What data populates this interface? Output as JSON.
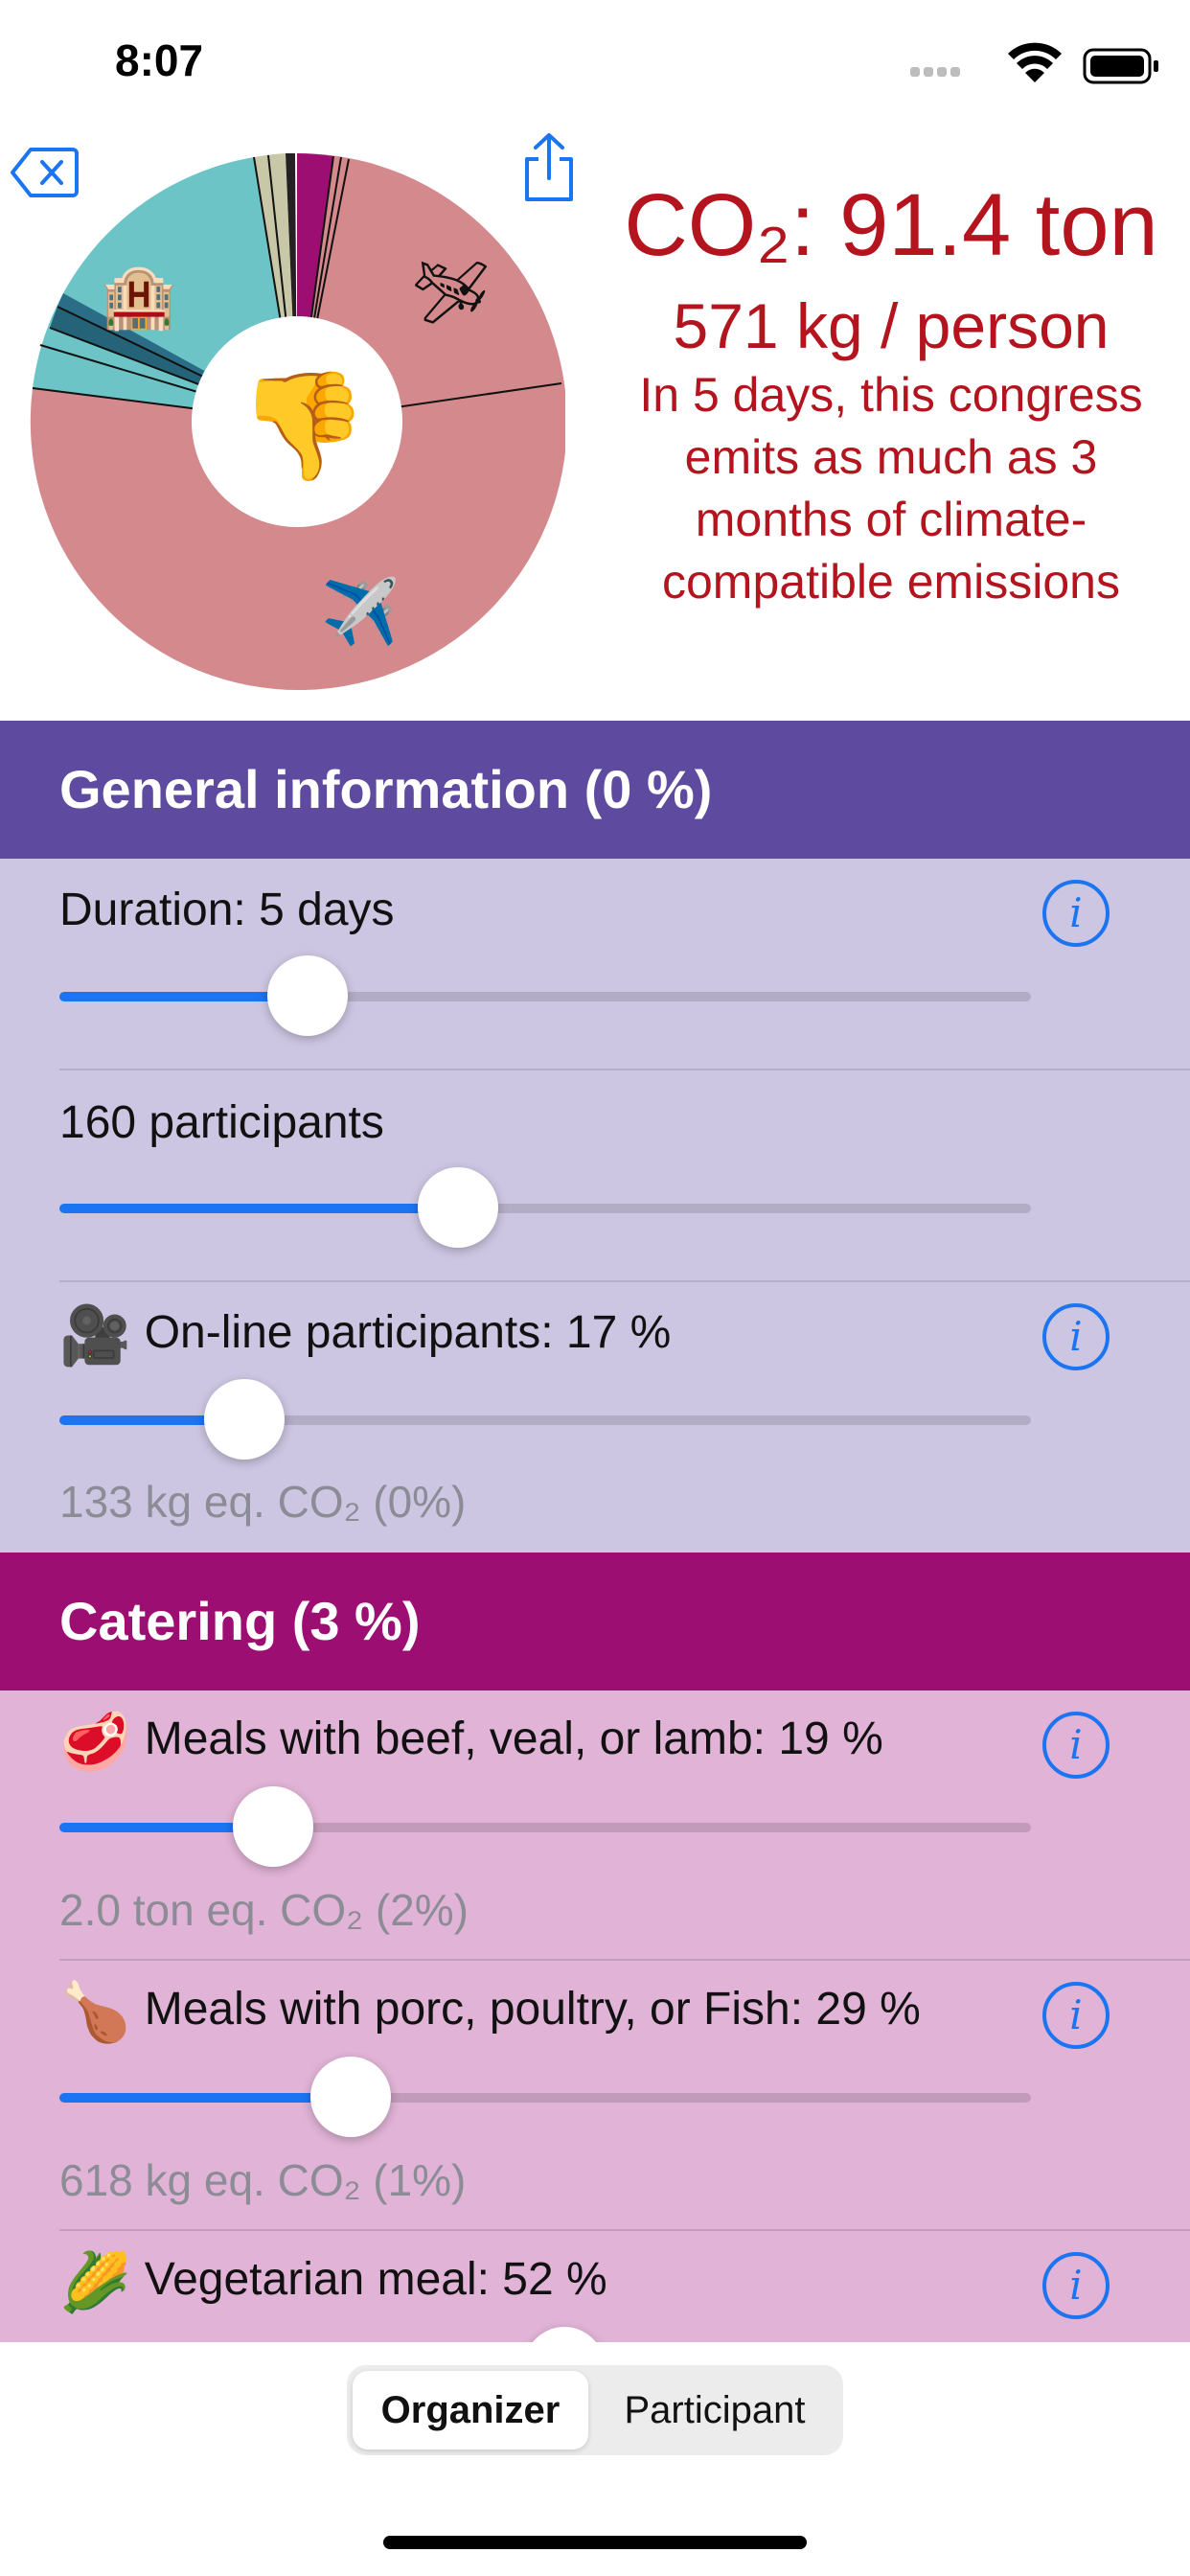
{
  "status": {
    "time": "8:07"
  },
  "header": {
    "co2_title": "CO₂: 91.4 ton",
    "per_person": "571 kg / person",
    "summary": "In 5 days, this congress emits as much as 3 months of climate-compatible emissions",
    "center_emoji": "👎",
    "pie_emojis": {
      "hotel": "🏨",
      "plane_small": "🛩",
      "plane": "✈️"
    }
  },
  "colors": {
    "accent": "#1b75f2",
    "alert_red": "#b3141e",
    "general_header": "#5e4a9f",
    "general_body": "#cdc6e2",
    "catering_header": "#9c0e72",
    "catering_body": "#e1b3d6",
    "pie_travel": "#d4898c",
    "pie_hotel": "#6cc4c6"
  },
  "sections": {
    "general": {
      "title": "General information (0 %)",
      "rows": [
        {
          "label": "Duration: 5 days",
          "slider": 0.255
        },
        {
          "label": "160 participants",
          "slider": 0.41
        },
        {
          "emoji": "🎥",
          "label": "On-line participants: 17 %",
          "slider": 0.19,
          "value": "133 kg eq. CO₂ (0%)"
        }
      ]
    },
    "catering": {
      "title": "Catering (3 %)",
      "rows": [
        {
          "emoji": "🥩",
          "label": "Meals with beef, veal, or lamb: 19 %",
          "slider": 0.22,
          "value": "2.0 ton eq. CO₂ (2%)"
        },
        {
          "emoji": "🍗",
          "label": "Meals with porc, poultry, or Fish: 29 %",
          "slider": 0.3,
          "value": "618 kg eq. CO₂ (1%)"
        },
        {
          "emoji": "🌽",
          "label": "Vegetarian meal: 52 %",
          "slider": 0.52
        }
      ]
    }
  },
  "tabs": {
    "organizer": "Organizer",
    "participant": "Participant"
  },
  "icons": {
    "back": "delete-left-icon",
    "share": "share-icon",
    "info": "info-circle-icon",
    "wifi": "wifi-icon",
    "battery": "battery-icon",
    "signal": "cellular-signal-icon"
  }
}
